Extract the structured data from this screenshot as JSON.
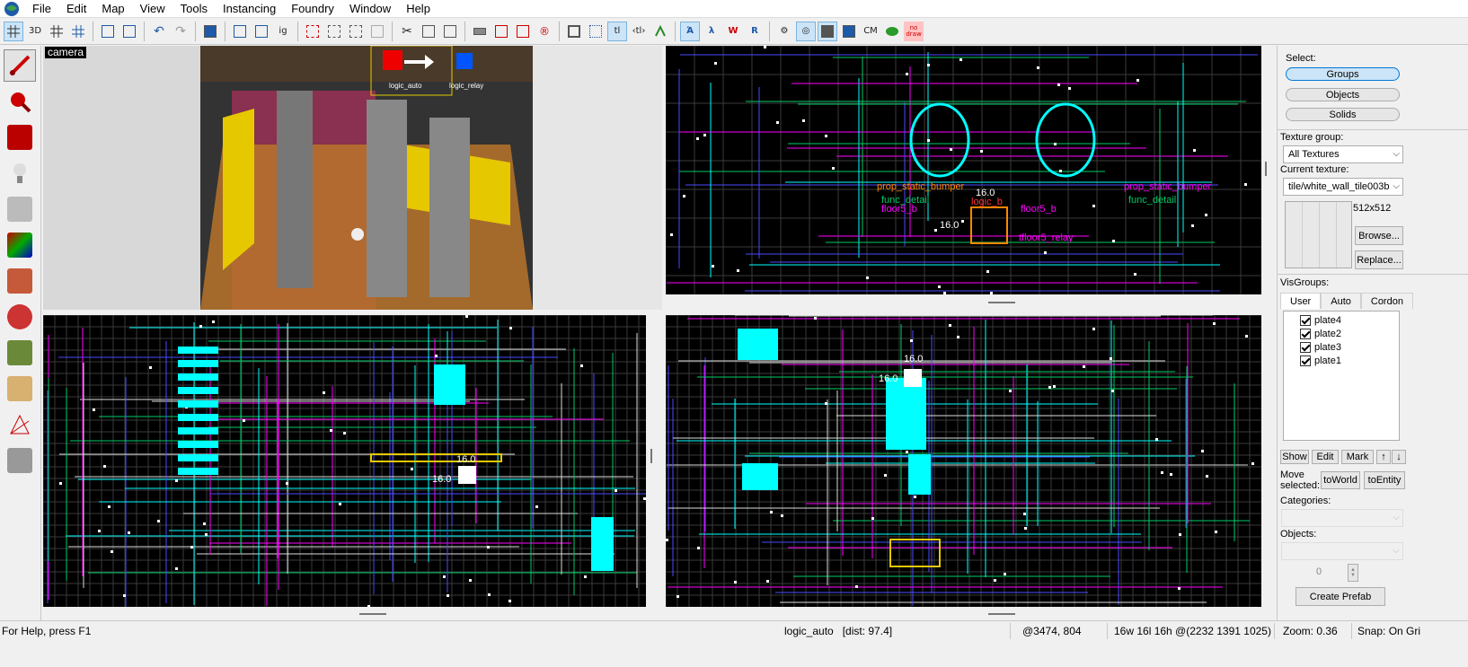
{
  "menu": [
    "File",
    "Edit",
    "Map",
    "View",
    "Tools",
    "Instancing",
    "Foundry",
    "Window",
    "Help"
  ],
  "toolbar": {
    "icons": [
      "grid-icon",
      "3d-grid-icon",
      "grid-smaller-icon",
      "grid-larger-icon",
      "copy-icon",
      "paste-icon",
      "undo-icon",
      "redo-icon",
      "carve-icon",
      "group-icon",
      "ungroup-icon",
      "ignore-groups-icon",
      "hide-icon",
      "show-icon",
      "cut-icon",
      "copy2-icon",
      "paste2-icon",
      "texture-lock-icon",
      "decal-icon",
      "overlay-icon",
      "radius-icon",
      "selection-icon",
      "texlock-icon",
      "tl",
      "tl-2",
      "flip-icon",
      "camera-icon",
      "draw-icon",
      "wireframe-icon",
      "polygon-icon",
      "textured-icon",
      "lightmap-icon",
      "cm-icon",
      "leaf-icon",
      "nodraw-icon"
    ],
    "text_items": {
      "ig": "ig",
      "tl": "tl",
      "tl2": "‹tl›",
      "cm": "CM",
      "nodraw": "no draw"
    }
  },
  "left_tools": [
    "selection-tool",
    "magnify-tool",
    "camera-tool",
    "entity-tool",
    "block-tool",
    "texture-tool",
    "apply-texture-tool",
    "decal-tool",
    "overlay-tool",
    "clip-tool",
    "vertex-tool",
    "path-tool"
  ],
  "camera_view": {
    "label": "camera",
    "entity_labels": [
      "logic_auto",
      "logic_relay"
    ]
  },
  "views": {
    "top_right": {
      "labels_magenta": [
        "prop_static_bumper",
        "prop_static_bumper",
        "tfloor5_relay",
        "floor5_b",
        "floor5_b",
        "logic_b"
      ],
      "labels_green": [
        "func_detail",
        "func_detail"
      ],
      "dimension_x": "16.0",
      "dimension_y": "16.0"
    },
    "bottom_left": {
      "dimension_x": "16.0",
      "dimension_y": "16.0"
    },
    "bottom_right": {
      "dimension_x": "16.0",
      "dimension_y": "16.0"
    }
  },
  "right_panel": {
    "select_label": "Select:",
    "select_buttons": [
      "Groups",
      "Objects",
      "Solids"
    ],
    "selected": "Groups",
    "texture_group_label": "Texture group:",
    "texture_group_value": "All Textures",
    "current_texture_label": "Current texture:",
    "current_texture_value": "tile/white_wall_tile003b",
    "texture_size": "512x512",
    "browse_button": "Browse...",
    "replace_button": "Replace...",
    "visgroups_label": "VisGroups:",
    "vis_tabs": [
      "User",
      "Auto",
      "Cordon"
    ],
    "vis_items": [
      "plate4",
      "plate2",
      "plate3",
      "plate1"
    ],
    "buttons_row": [
      "Show",
      "Edit",
      "Mark"
    ],
    "move_selected_label": "Move selected:",
    "to_world_button": "toWorld",
    "to_entity_button": "toEntity",
    "categories_label": "Categories:",
    "objects_label": "Objects:",
    "spinner_value": "0",
    "create_prefab_button": "Create Prefab"
  },
  "status": {
    "help": "For Help, press F1",
    "selection": "logic_auto   [dist: 97.4]",
    "coords": "@3474, 804",
    "size": "16w 16l 16h @(2232 1391 1025)",
    "zoom": "Zoom: 0.36",
    "snap": "Snap: On Gri"
  },
  "colors": {
    "accent": "#00ffff",
    "magenta": "#ff00ff",
    "grid": "#333333",
    "selected_border": "#0078d7"
  }
}
